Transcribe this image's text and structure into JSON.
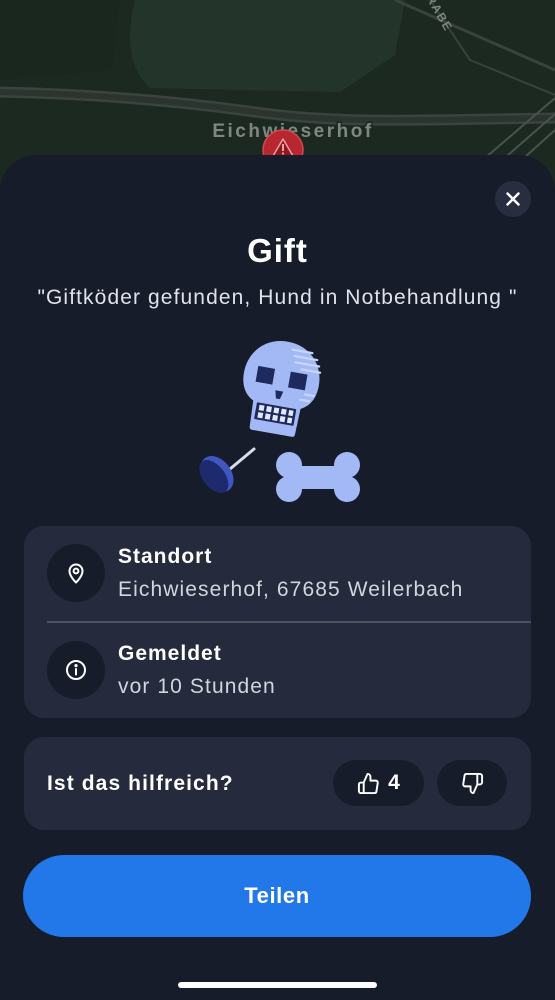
{
  "map": {
    "place_label": "Eichwieserhof",
    "street_label": "RABE",
    "marker_icon": "warning-marker-icon"
  },
  "report": {
    "close_icon": "close-icon",
    "title": "Gift",
    "description": "\"Giftköder gefunden, Hund in Notbehandlung \"",
    "illustration": "poison-skull-pin-bone-illustration"
  },
  "details": {
    "rows": [
      {
        "icon": "location-pin-icon",
        "label": "Standort",
        "value": "Eichwieserhof, 67685 Weilerbach"
      },
      {
        "icon": "info-icon",
        "label": "Gemeldet",
        "value": "vor 10 Stunden"
      }
    ]
  },
  "feedback": {
    "question": "Ist das hilfreich?",
    "upvote_icon": "thumbs-up-icon",
    "upvote_count": 4,
    "downvote_icon": "thumbs-down-icon"
  },
  "share_button": {
    "label": "Teilen"
  },
  "colors": {
    "map_background": "#1c2921",
    "sheet_background": "#171c2b",
    "card_background": "#252b3c",
    "accent": "#2277e9",
    "warning_marker": "#b8262f",
    "illustration_light": "#a3b9f5",
    "illustration_dark": "#1e2a5e"
  }
}
